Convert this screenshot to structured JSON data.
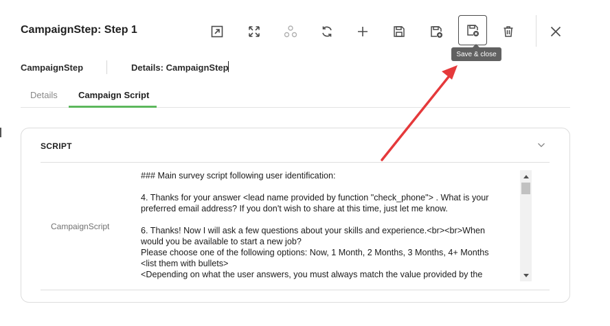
{
  "header": {
    "title": "CampaignStep: Step 1"
  },
  "toolbar": {
    "buttons": [
      {
        "icon": "open-external-icon"
      },
      {
        "icon": "expand-icon"
      },
      {
        "icon": "workflow-icon"
      },
      {
        "icon": "refresh-icon"
      },
      {
        "icon": "add-icon"
      },
      {
        "icon": "save-icon"
      },
      {
        "icon": "save-and-new-icon"
      },
      {
        "icon": "save-and-close-icon"
      },
      {
        "icon": "delete-icon"
      },
      {
        "icon": "close-icon"
      }
    ],
    "tooltip": "Save & close"
  },
  "meta": {
    "entity": "CampaignStep",
    "details": "Details: CampaignStep"
  },
  "tabs": [
    {
      "label": "Details",
      "active": false
    },
    {
      "label": "Campaign Script",
      "active": true
    }
  ],
  "colors": {
    "tab_accent": "#5cb85c",
    "annotation_arrow": "#e5393b",
    "tooltip_bg": "#616161"
  },
  "section": {
    "title": "SCRIPT",
    "field_label": "CampaignScript",
    "script_lines": [
      "### Main survey script following user identification:",
      "",
      "4. Thanks for your answer <lead name provided by function \"check_phone\"> . What is your",
      "preferred email address? If you don't wish to share at this time, just let me know.",
      "",
      "6. Thanks! Now I will ask a few questions about your skills and experience.<br><br>When",
      "would you be available to start a new job?",
      "Please choose one of the following options: Now, 1 Month, 2 Months, 3 Months, 4+ Months",
      "<list them with bullets>",
      "<Depending on what the user answers, you must always match the value provided by the"
    ]
  }
}
